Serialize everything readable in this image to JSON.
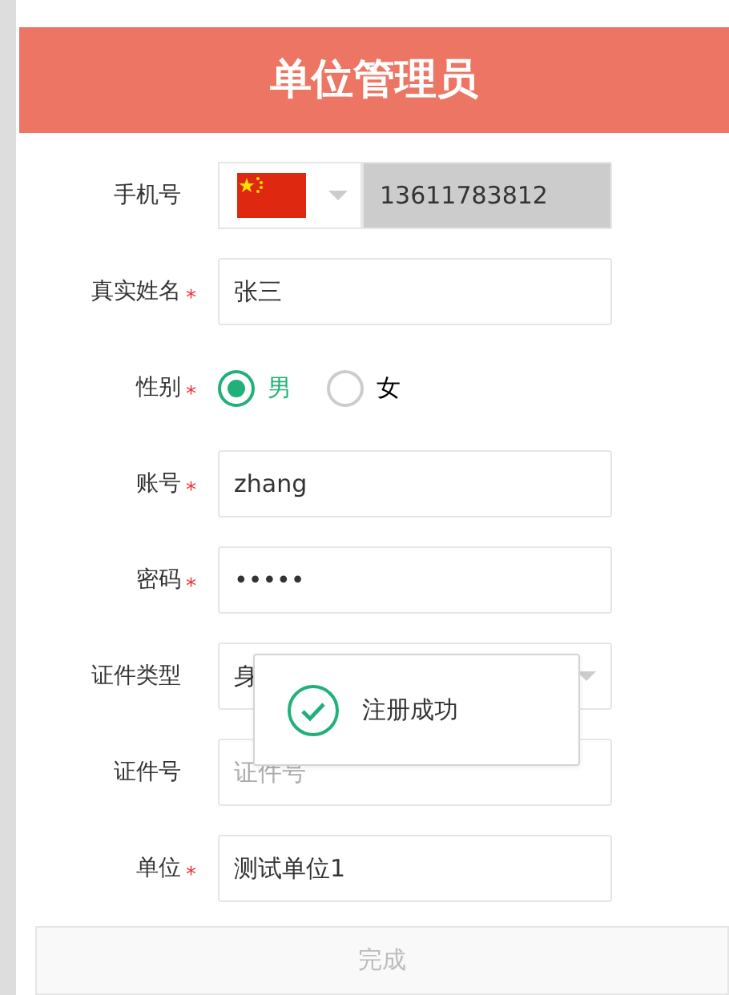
{
  "header": {
    "title": "单位管理员"
  },
  "required_mark": "*",
  "fields": [
    {
      "kind": "phone",
      "label": "手机号",
      "required": false,
      "value": "13611783812",
      "disabled": true
    },
    {
      "kind": "text",
      "label": "真实姓名",
      "required": true,
      "value": "张三"
    },
    {
      "kind": "radio",
      "label": "性别",
      "required": true,
      "options": [
        {
          "label": "男",
          "selected": true
        },
        {
          "label": "女",
          "selected": false
        }
      ]
    },
    {
      "kind": "text",
      "label": "账号",
      "required": true,
      "value": "zhang"
    },
    {
      "kind": "text",
      "label": "密码",
      "required": true,
      "value": "•••••"
    },
    {
      "kind": "select",
      "label": "证件类型",
      "required": false,
      "value": "身"
    },
    {
      "kind": "text",
      "label": "证件号",
      "required": false,
      "placeholder": "证件号"
    },
    {
      "kind": "text",
      "label": "单位",
      "required": true,
      "value": "测试单位1"
    }
  ],
  "submit": {
    "label": "完成",
    "disabled": true
  },
  "toast": {
    "kind": "success",
    "message": "注册成功"
  }
}
